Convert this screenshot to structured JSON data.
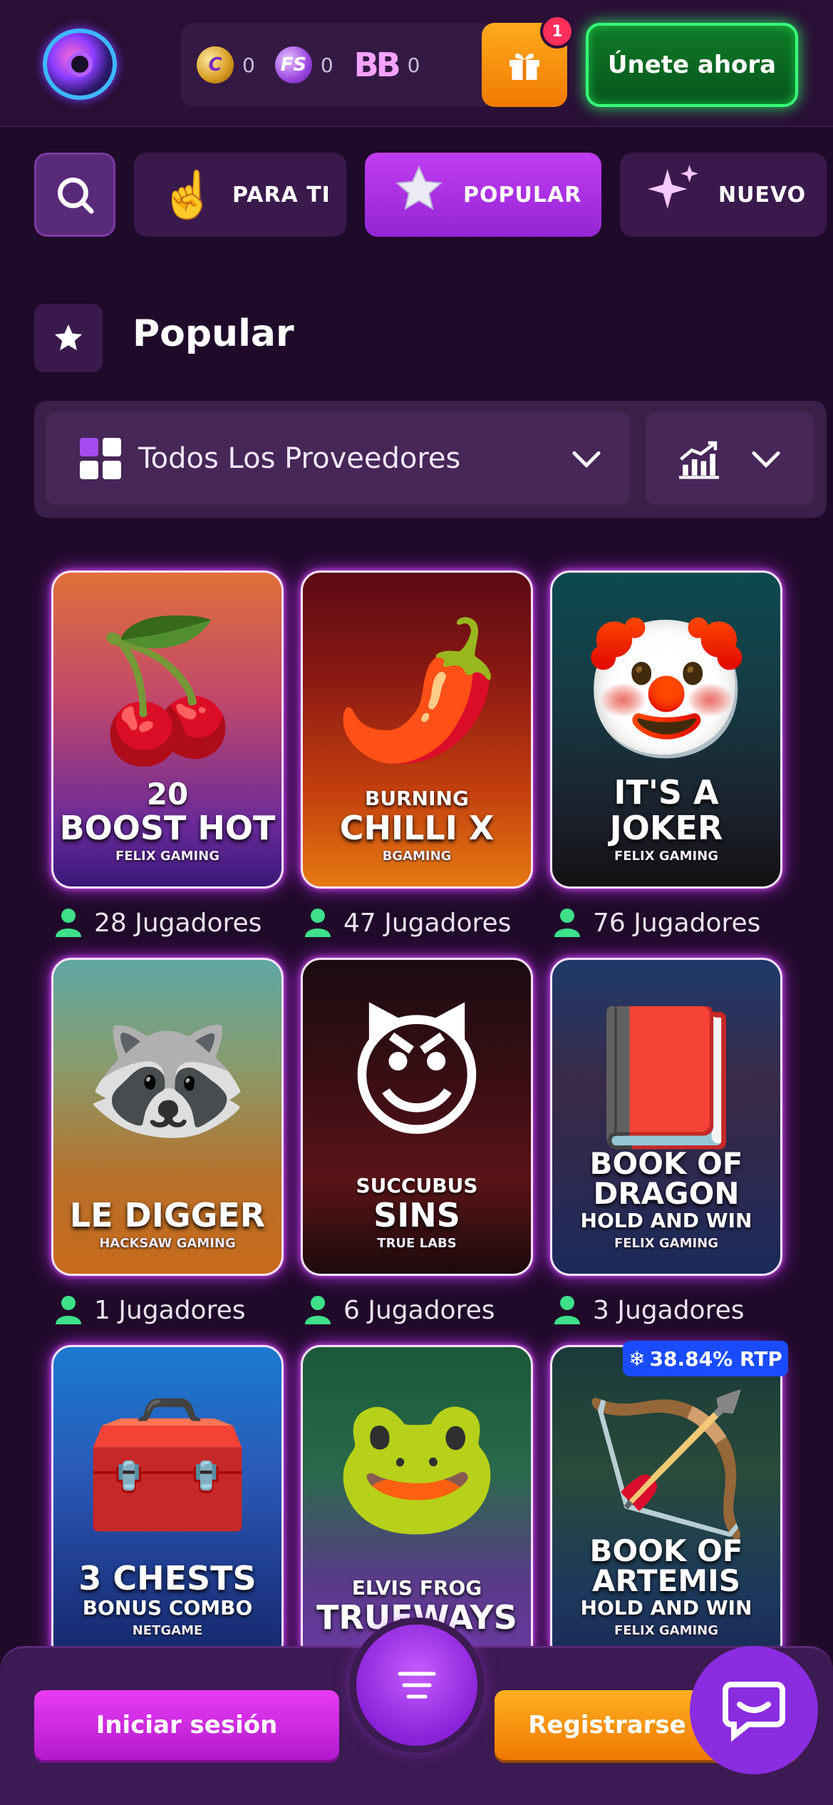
{
  "header": {
    "balances": [
      {
        "name": "coin",
        "glyph": "C",
        "value": "0"
      },
      {
        "name": "free-spins",
        "glyph": "FS",
        "value": "0"
      },
      {
        "name": "bonus",
        "glyph": "BB",
        "value": "0"
      }
    ],
    "gift_badge": "1",
    "join_label": "Únete ahora"
  },
  "tabs": [
    {
      "label": "PARA TI",
      "icon": "pointing-hand-icon"
    },
    {
      "label": "POPULAR",
      "icon": "star-icon"
    },
    {
      "label": "NUEVO",
      "icon": "sparkles-icon"
    }
  ],
  "section": {
    "title": "Popular"
  },
  "filter": {
    "provider_label": "Todos Los Proveedores"
  },
  "games": [
    {
      "pre": "20",
      "title": "BOOST HOT",
      "sub": "",
      "provider": "FELIX GAMING",
      "players": "28 Jugadores",
      "art": "🍒"
    },
    {
      "pre": "BURNING",
      "title": "CHILLI X",
      "sub": "",
      "provider": "BGAMING",
      "players": "47 Jugadores",
      "art": "🌶️"
    },
    {
      "pre": "",
      "title": "IT'S A JOKER",
      "sub": "",
      "provider": "FELIX GAMING",
      "players": "76 Jugadores",
      "art": "🤡"
    },
    {
      "pre": "",
      "title": "LE DIGGER",
      "sub": "",
      "provider": "HACKSAW GAMING",
      "players": "1 Jugadores",
      "art": "🦝"
    },
    {
      "pre": "SUCCUBUS",
      "title": "SINS",
      "sub": "",
      "provider": "TRUE LABS",
      "players": "6 Jugadores",
      "art": "😈"
    },
    {
      "pre": "",
      "title": "BOOK OF DRAGON",
      "sub": "HOLD AND WIN",
      "provider": "FELIX GAMING",
      "players": "3 Jugadores",
      "art": "📕"
    },
    {
      "pre": "",
      "title": "3 CHESTS",
      "sub": "BONUS COMBO",
      "provider": "NETGAME",
      "players": "",
      "art": "🧰"
    },
    {
      "pre": "ELVIS FROG",
      "title": "TRUEWAYS",
      "sub": "",
      "provider": "",
      "players": "",
      "art": "🐸"
    },
    {
      "pre": "",
      "title": "BOOK OF ARTEMIS",
      "sub": "HOLD AND WIN",
      "provider": "FELIX GAMING",
      "players": "",
      "art": "🏹"
    }
  ],
  "rtp_badge": "38.84% RTP",
  "bottom": {
    "login_label": "Iniciar sesión",
    "register_label": "Registrarse"
  },
  "colors": {
    "background": "#200a2a",
    "accent_purple": "#c13cf2",
    "join_green": "#38ff78",
    "gift_orange": "#ffaa1e",
    "rtp_blue": "#1a4cff"
  }
}
